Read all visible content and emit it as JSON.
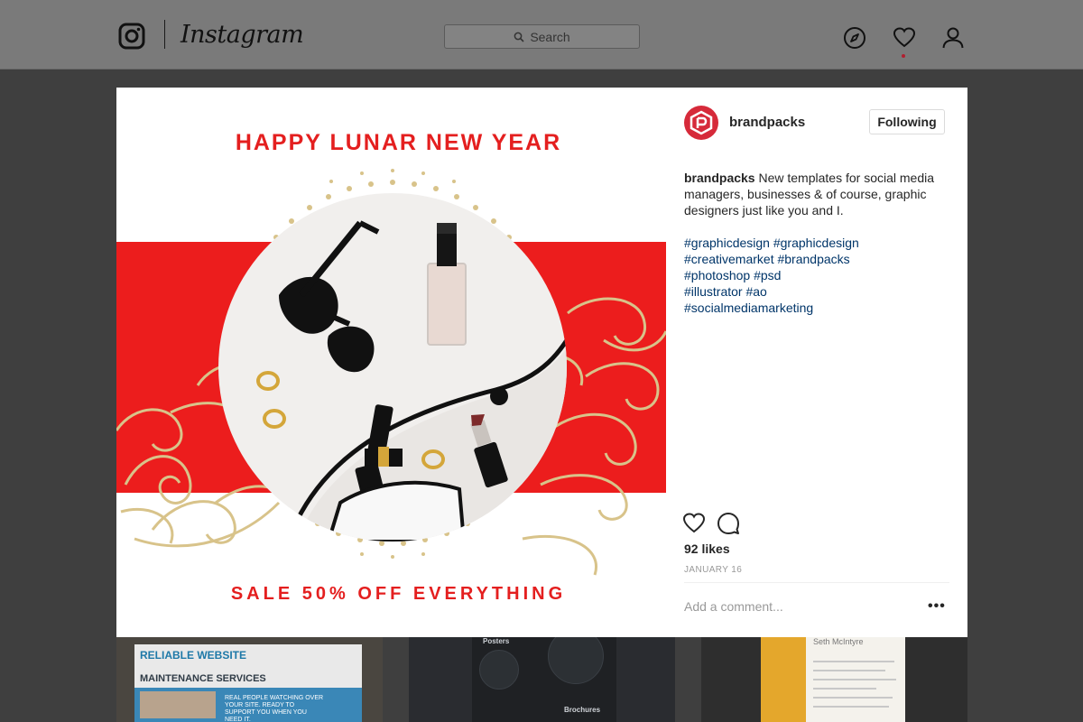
{
  "nav": {
    "wordmark": "Instagram",
    "search_placeholder": "Search",
    "icons": [
      "instagram-glyph-icon",
      "compass-icon",
      "heart-icon",
      "profile-icon"
    ],
    "notification_color": "#b02030"
  },
  "post": {
    "image": {
      "title": "HAPPY LUNAR NEW YEAR",
      "sale": "SALE 50% OFF EVERYTHING",
      "accent_color": "#e41f1f",
      "gold_color": "#d8c38a"
    },
    "username": "brandpacks",
    "follow_label": "Following",
    "caption_user": "brandpacks",
    "caption_text": " New templates for social media managers, businesses & of course, graphic designers just like you and I.",
    "hashtags": [
      "#graphicdesign #graphicdesign",
      "#creativemarket #brandpacks",
      "#photoshop #psd",
      "#illustrator #ao",
      "#socialmediamarketing"
    ],
    "likes": "92 likes",
    "date": "JANUARY 16",
    "comment_placeholder": "Add a comment...",
    "more_label": "•••"
  },
  "background_tiles": {
    "tile1": {
      "headline": "RELIABLE WEBSITE",
      "subhead": "MAINTENANCE SERVICES",
      "note": "REAL PEOPLE WATCHING OVER YOUR SITE. READY TO SUPPORT YOU WHEN YOU NEED IT."
    },
    "tile2": {
      "label_top": "Posters",
      "label_bottom": "Brochures"
    },
    "tile3": {
      "name": "Seth McIntyre"
    }
  }
}
